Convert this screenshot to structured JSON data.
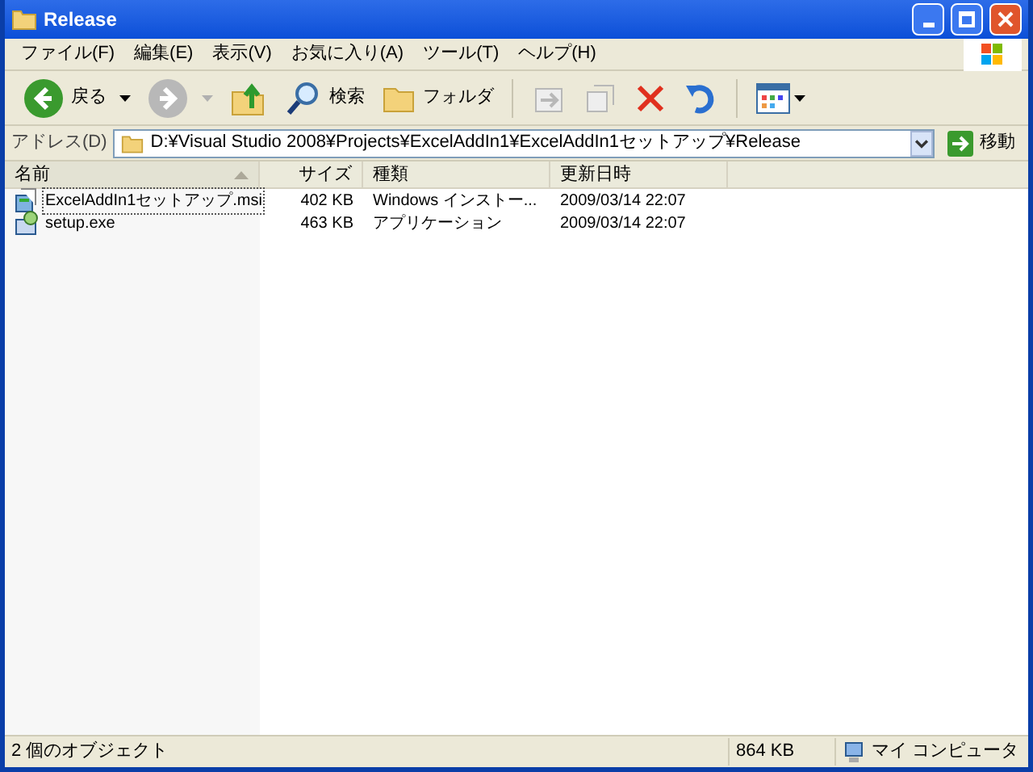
{
  "window": {
    "title": "Release"
  },
  "menu": [
    "ファイル(F)",
    "編集(E)",
    "表示(V)",
    "お気に入り(A)",
    "ツール(T)",
    "ヘルプ(H)"
  ],
  "toolbar": [
    {
      "kind": "back",
      "label": "戻る",
      "disabled": false
    },
    {
      "kind": "forward",
      "disabled": true
    },
    {
      "kind": "up",
      "disabled": false
    },
    {
      "kind": "search",
      "label": "検索",
      "disabled": false
    },
    {
      "kind": "folders",
      "label": "フォルダ",
      "disabled": false
    },
    {
      "kind": "move",
      "disabled": true
    },
    {
      "kind": "copy",
      "disabled": true
    },
    {
      "kind": "delete",
      "disabled": false
    },
    {
      "kind": "undo",
      "disabled": false
    },
    {
      "kind": "views",
      "disabled": false
    }
  ],
  "address": {
    "label": "アドレス(D)",
    "value": "D:¥Visual Studio 2008¥Projects¥ExcelAddIn1¥ExcelAddIn1セットアップ¥Release",
    "go": "移動"
  },
  "columns": [
    {
      "label": "名前",
      "sorted": true
    },
    {
      "label": "サイズ",
      "sorted": false
    },
    {
      "label": "種類",
      "sorted": false
    },
    {
      "label": "更新日時",
      "sorted": false
    }
  ],
  "rows": [
    {
      "kind": "msi",
      "name": "ExcelAddIn1セットアップ.msi",
      "size": "402 KB",
      "type": "Windows インストー...",
      "date": "2009/03/14 22:07",
      "focused": true
    },
    {
      "kind": "exe",
      "name": "setup.exe",
      "size": "463 KB",
      "type": "アプリケーション",
      "date": "2009/03/14 22:07",
      "focused": false
    }
  ],
  "status_bar": {
    "objects": "2 個のオブジェクト",
    "size": "864 KB",
    "location": "マイ コンピュータ"
  }
}
